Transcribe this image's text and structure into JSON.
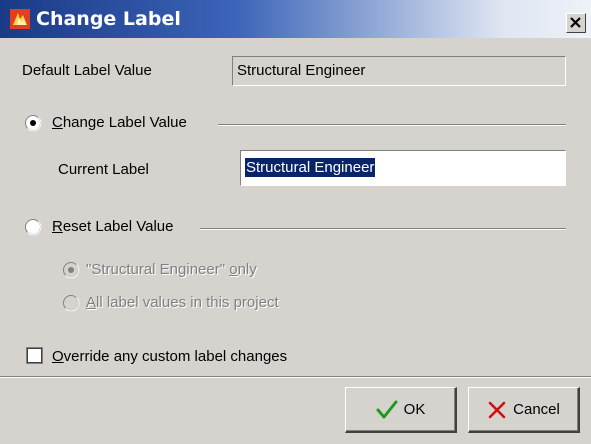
{
  "window": {
    "title": "Change Label",
    "close_icon": "close-icon",
    "app_icon": "app-icon"
  },
  "default_label": {
    "label": "Default Label Value",
    "value": "Structural Engineer"
  },
  "change_option": {
    "label_first": "C",
    "label_rest": "hange Label Value",
    "checked": true
  },
  "current_label": {
    "label": "Current Label",
    "value": "Structural Engineer"
  },
  "reset_option": {
    "label_first": "R",
    "label_rest": "eset Label Value",
    "checked": false,
    "sub_options": [
      {
        "text_pre": "\"Structural Engineer\" ",
        "text_ul": "o",
        "text_post": "nly",
        "checked": true,
        "enabled": false
      },
      {
        "text_pre": "",
        "text_ul": "A",
        "text_post": "ll label values in this project",
        "checked": false,
        "enabled": false
      }
    ]
  },
  "override": {
    "label_first": "O",
    "label_rest": "verride any custom label changes",
    "checked": false
  },
  "buttons": {
    "ok": "OK",
    "cancel": "Cancel"
  },
  "colors": {
    "title_start": "#1a3a86",
    "dialog_bg": "#d6d3ce",
    "selection": "#0a246a",
    "ok_check": "#1f9a1f",
    "cancel_x": "#d01010"
  }
}
